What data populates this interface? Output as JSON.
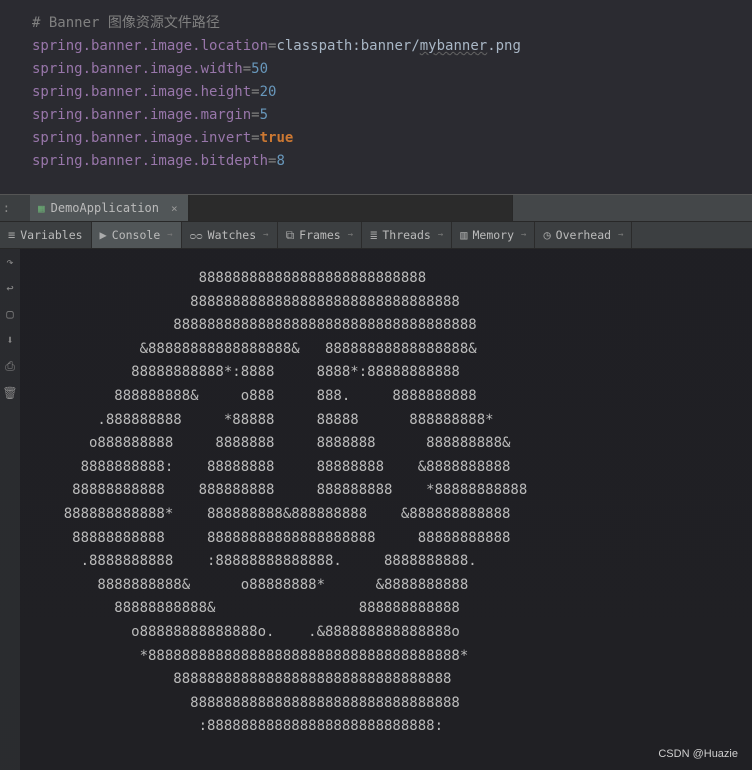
{
  "editor": {
    "comment": "# Banner 图像资源文件路径",
    "lines": [
      {
        "key": "spring.banner.image.location",
        "val": "classpath:banner/<wavy>mybanner</wavy>.png",
        "type": "text"
      },
      {
        "key": "spring.banner.image.width",
        "val": "50",
        "type": "num"
      },
      {
        "key": "spring.banner.image.height",
        "val": "20",
        "type": "num"
      },
      {
        "key": "spring.banner.image.margin",
        "val": "5",
        "type": "num"
      },
      {
        "key": "spring.banner.image.invert",
        "val": "true",
        "type": "kw"
      },
      {
        "key": "spring.banner.image.bitdepth",
        "val": "8",
        "type": "num"
      }
    ]
  },
  "sideLabel": ":",
  "fileTab": {
    "label": "DemoApplication",
    "close": "×",
    "iconGlyph": "▦"
  },
  "toolTabs": {
    "variables": "Variables",
    "console": "Console",
    "watches": "Watches",
    "frames": "Frames",
    "threads": "Threads",
    "memory": "Memory",
    "overhead": "Overhead"
  },
  "gutterIcons": {
    "resume": "↷",
    "stepBack": "↩",
    "pause": "▢",
    "download": "⬇",
    "print": "⎙",
    "delete": "🗑"
  },
  "consoleAscii": "                    888888888888888888888888888\n                   88888888888888888888888888888888\n                 888888888888888888888888888888888888\n             &88888888888888888&   88888888888888888&\n            88888888888*:8888     8888*:88888888888\n          888888888&     o888     888.     8888888888\n        .888888888     *88888     88888      888888888*\n       o888888888     8888888     8888888      888888888&\n      8888888888:    88888888     88888888    &8888888888\n     88888888888    888888888     888888888    *88888888888\n    888888888888*    888888888&888888888    &888888888888\n     88888888888     88888888888888888888     88888888888\n      .8888888888    :88888888888888.     8888888888.\n        8888888888&      o88888888*      &8888888888\n          88888888888&                 888888888888\n            o88888888888888o.    .&888888888888888o\n             *8888888888888888888888888888888888888*\n                 888888888888888888888888888888888\n                   88888888888888888888888888888888\n                    :888888888888888888888888888:",
  "watermark": "CSDN @Huazie"
}
